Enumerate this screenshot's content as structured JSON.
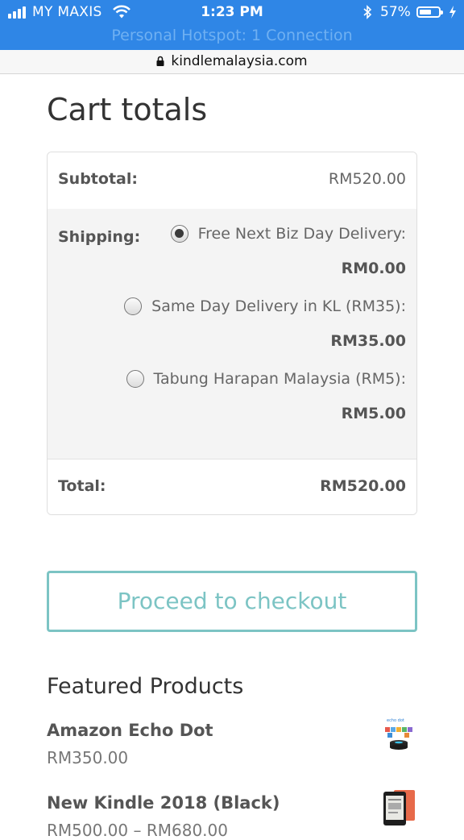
{
  "status_bar": {
    "carrier": "MY MAXIS",
    "time": "1:23 PM",
    "battery": "57%",
    "hotspot": "Personal Hotspot: 1 Connection"
  },
  "browser": {
    "url": "kindlemalaysia.com"
  },
  "cart": {
    "title": "Cart totals",
    "subtotal_label": "Subtotal:",
    "subtotal_value": "RM520.00",
    "shipping_label": "Shipping:",
    "shipping_options": [
      {
        "label": "Free Next Biz Day Delivery:",
        "price": "RM0.00",
        "selected": true
      },
      {
        "label": "Same Day Delivery in KL (RM35):",
        "price": "RM35.00",
        "selected": false
      },
      {
        "label": "Tabung Harapan Malaysia (RM5):",
        "price": "RM5.00",
        "selected": false
      }
    ],
    "total_label": "Total:",
    "total_value": "RM520.00"
  },
  "checkout_button": "Proceed to checkout",
  "featured": {
    "heading": "Featured Products",
    "products": [
      {
        "name": "Amazon Echo Dot",
        "price": "RM350.00",
        "thumb_text": "echo dot"
      },
      {
        "name": "New Kindle 2018 (Black)",
        "price": "RM500.00 – RM680.00"
      }
    ]
  },
  "colors": {
    "status_bar": "#2f86e6",
    "accent": "#7cc4c4"
  }
}
